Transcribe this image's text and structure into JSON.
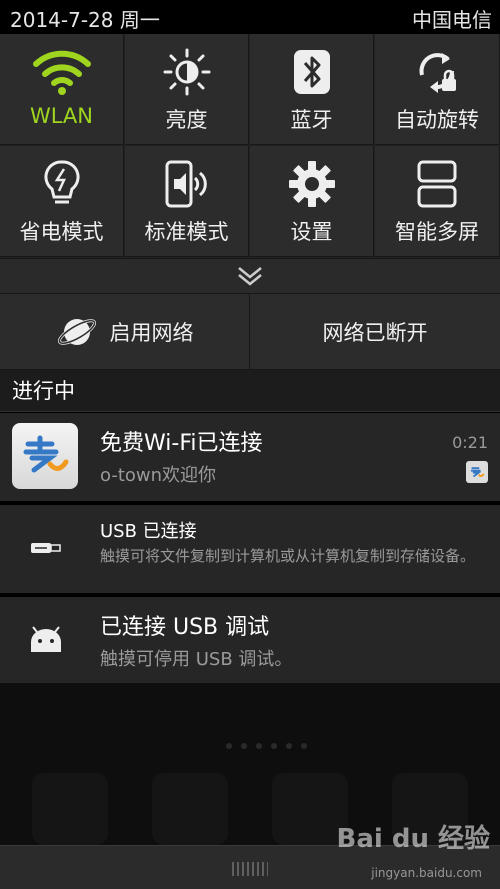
{
  "status_bar": {
    "date": "2014-7-28 周一",
    "carrier": "中国电信"
  },
  "quick_settings": [
    {
      "label": "WLAN",
      "icon": "wifi-icon",
      "active": true
    },
    {
      "label": "亮度",
      "icon": "brightness-icon",
      "active": false
    },
    {
      "label": "蓝牙",
      "icon": "bluetooth-icon",
      "active": false
    },
    {
      "label": "自动旋转",
      "icon": "auto-rotate-icon",
      "active": false
    },
    {
      "label": "省电模式",
      "icon": "power-saving-icon",
      "active": false
    },
    {
      "label": "标准模式",
      "icon": "sound-mode-icon",
      "active": false
    },
    {
      "label": "设置",
      "icon": "gear-icon",
      "active": false
    },
    {
      "label": "智能多屏",
      "icon": "multi-screen-icon",
      "active": false
    }
  ],
  "network": {
    "enable_label": "启用网络",
    "status_label": "网络已断开"
  },
  "ongoing": {
    "header": "进行中"
  },
  "notifications": [
    {
      "title": "免费Wi-Fi已连接",
      "subtitle": "o-town欢迎你",
      "time": "0:21"
    },
    {
      "title": "USB 已连接",
      "subtitle": "触摸可将文件复制到计算机或从计算机复制到存储设备。"
    },
    {
      "title": "已连接 USB 调试",
      "subtitle": "触摸可停用 USB 调试。"
    }
  ],
  "watermark": {
    "text": "Bai du 经验",
    "sub": "jingyan.baidu.com"
  },
  "colors": {
    "accent_green": "#9fd51f",
    "panel": "#2c2c2c",
    "background": "#000000"
  }
}
